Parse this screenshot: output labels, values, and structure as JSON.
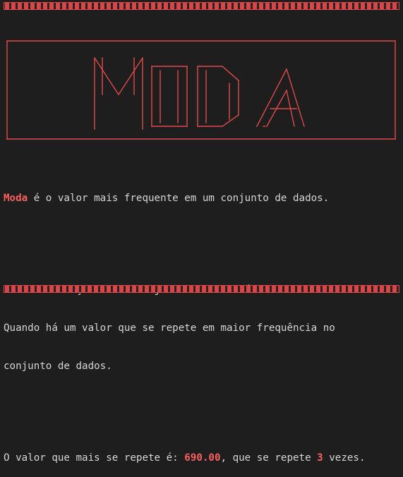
{
  "banner": {
    "title": "MODA",
    "color": "#e0494a"
  },
  "content": {
    "definition": {
      "term": "Moda",
      "text": " é o valor mais frequente em um conjunto de dados."
    },
    "classification": {
      "prefix": "A classificação desse conjunto de dados é: ",
      "value": "MODAL",
      "suffix": "."
    },
    "explanation": {
      "line1": "Quando há um valor que se repete em maior frequência no",
      "line2": "conjunto de dados."
    },
    "result": {
      "prefix": "O valor que mais se repete é: ",
      "value": "690.00",
      "middle": ", que se repete ",
      "count": "3",
      "suffix": " vezes."
    }
  },
  "colors": {
    "background": "#1e1e1e",
    "text": "#d6d6d6",
    "accent": "#ff5f5f",
    "border": "#e0494a"
  }
}
